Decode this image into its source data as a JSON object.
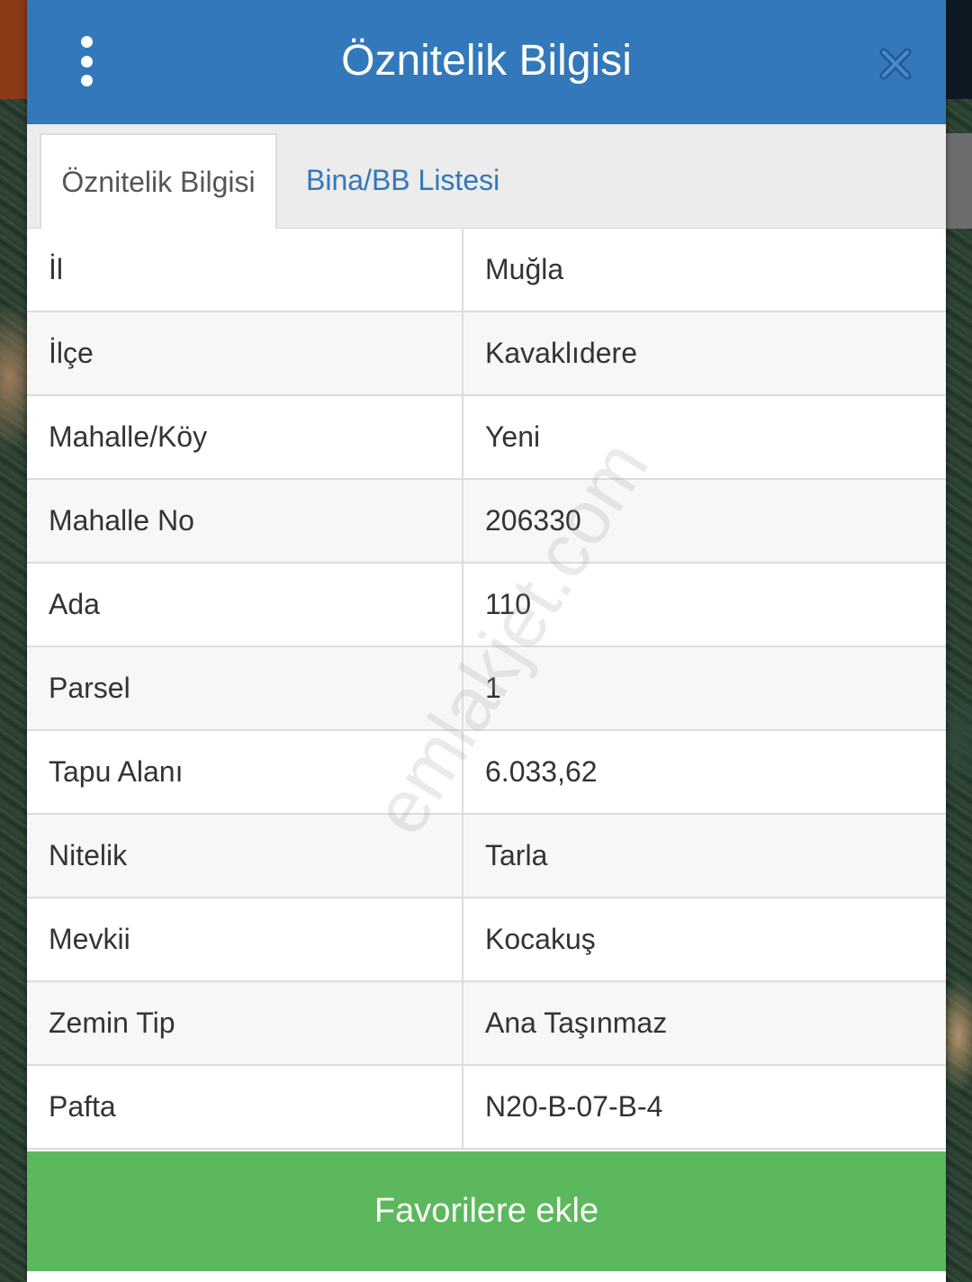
{
  "header": {
    "title": "Öznitelik Bilgisi",
    "menu_icon": "more-vertical-icon",
    "close_icon": "close-icon"
  },
  "tabs": [
    {
      "label": "Öznitelik Bilgisi",
      "active": true
    },
    {
      "label": "Bina/BB Listesi",
      "active": false
    }
  ],
  "table": {
    "rows": [
      {
        "key": "İl",
        "value": "Muğla"
      },
      {
        "key": "İlçe",
        "value": "Kavaklıdere"
      },
      {
        "key": "Mahalle/Köy",
        "value": "Yeni"
      },
      {
        "key": "Mahalle No",
        "value": "206330"
      },
      {
        "key": "Ada",
        "value": "110"
      },
      {
        "key": "Parsel",
        "value": "1"
      },
      {
        "key": "Tapu Alanı",
        "value": "6.033,62"
      },
      {
        "key": "Nitelik",
        "value": "Tarla"
      },
      {
        "key": "Mevkii",
        "value": "Kocakuş"
      },
      {
        "key": "Zemin Tip",
        "value": "Ana Taşınmaz"
      },
      {
        "key": "Pafta",
        "value": "N20-B-07-B-4"
      }
    ]
  },
  "favorite_button": {
    "label": "Favorilere ekle"
  },
  "watermark": "emlakjet.com",
  "colors": {
    "header": "#3278bb",
    "tab_link": "#3278bb",
    "favorite_button": "#5cb85c"
  }
}
